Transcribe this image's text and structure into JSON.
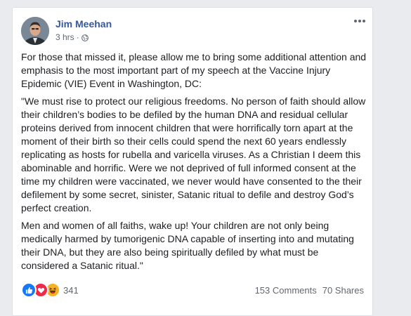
{
  "post": {
    "author": "Jim Meehan",
    "timestamp": "3 hrs",
    "separator": "·",
    "privacy_icon": "globe-icon",
    "paragraphs": [
      "For those that missed it, please allow me to bring some additional attention and emphasis to the most important part of my speech at the Vaccine Injury Epidemic (VIE) Event in Washington, DC:",
      "\"We must rise to protect our religious freedoms. No person of faith should allow their children’s bodies to be defiled by the human DNA and residual cellular proteins derived from innocent children that were horrifically torn apart at the moment of their birth so their cells could spend the next 60 years endlessly replicating as hosts for rubella and varicella viruses. As a Christian I deem this abominable and horrific. Were we not deprived of full informed consent at the time my children were vaccinated, we never would have consented to the their defilement by some secret, sinister, Satanic ritual to defile and destroy God’s perfect creation.",
      "Men and women of all faiths, wake up! Your children are not only being medically harmed by tumorigenic DNA capable of inserting into and mutating their DNA, but they are also being spiritually defiled by what must be considered a Satanic ritual.\""
    ]
  },
  "footer": {
    "reaction_icons": [
      "like-icon",
      "love-icon",
      "haha-icon"
    ],
    "reaction_count": "341",
    "comments": "153 Comments",
    "shares": "70 Shares"
  },
  "colors": {
    "author_link": "#385898",
    "like": "#1877f2",
    "love": "#f0284a",
    "haha": "#f7b125"
  }
}
